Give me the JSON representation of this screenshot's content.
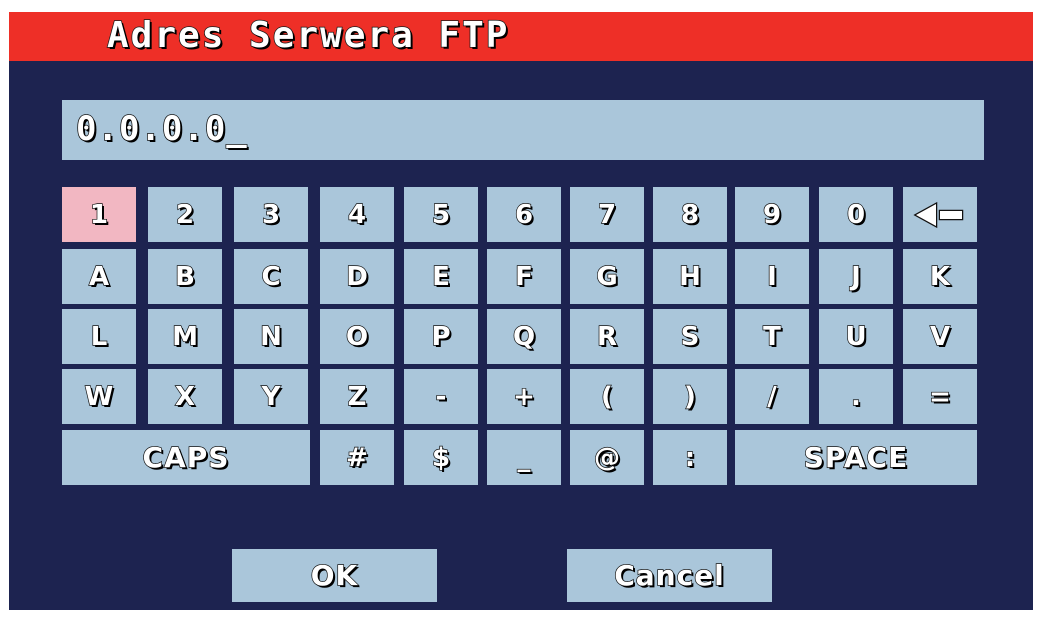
{
  "title": "Adres Serwera FTP",
  "input": {
    "value": "0.0.0.0_"
  },
  "colors": {
    "title_bar": "#ee2f27",
    "background": "#1d2350",
    "key": "#aac6da",
    "key_selected": "#f2b7c2"
  },
  "keyboard": {
    "selected_key": "1",
    "rows": [
      [
        "1",
        "2",
        "3",
        "4",
        "5",
        "6",
        "7",
        "8",
        "9",
        "0",
        "backspace"
      ],
      [
        "A",
        "B",
        "C",
        "D",
        "E",
        "F",
        "G",
        "H",
        "I",
        "J",
        "K"
      ],
      [
        "L",
        "M",
        "N",
        "O",
        "P",
        "Q",
        "R",
        "S",
        "T",
        "U",
        "V"
      ],
      [
        "W",
        "X",
        "Y",
        "Z",
        "-",
        "+",
        "(",
        ")",
        "/",
        ".",
        "="
      ],
      [
        "CAPS",
        "#",
        "$",
        "_",
        "@",
        ":",
        "SPACE"
      ]
    ],
    "backspace_icon": "backspace-arrow-icon"
  },
  "buttons": {
    "ok": "OK",
    "cancel": "Cancel"
  }
}
